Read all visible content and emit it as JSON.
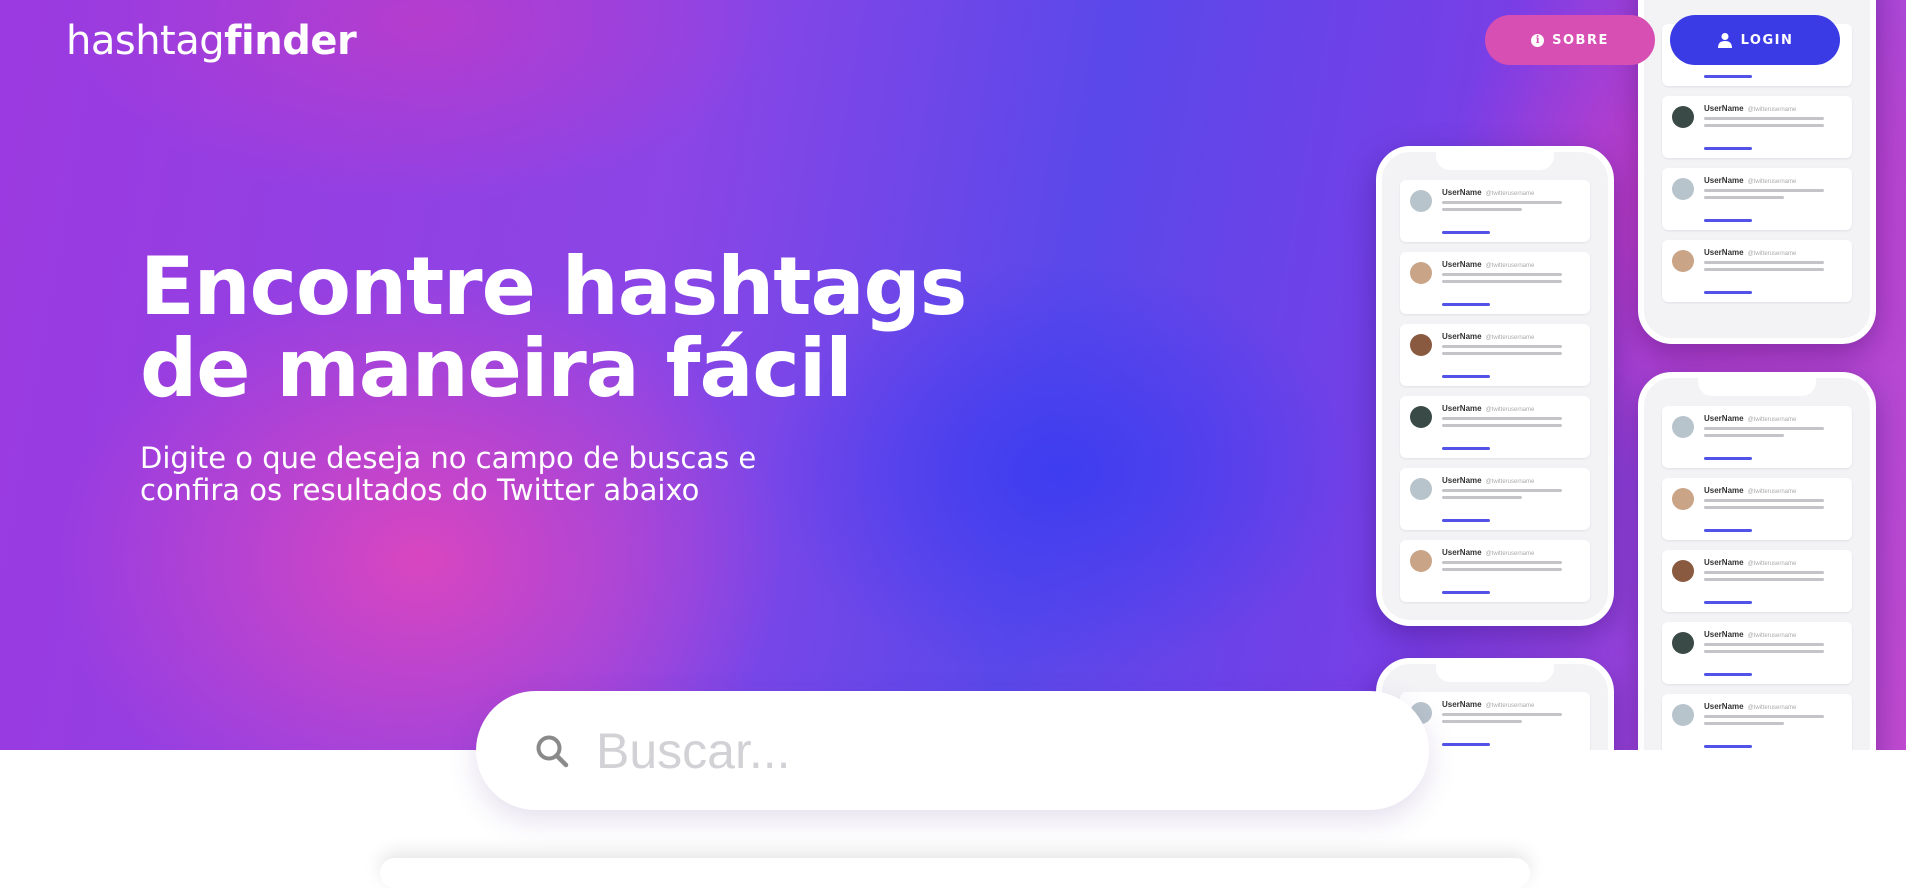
{
  "header": {
    "logo_part1": "hashtag",
    "logo_part2": "finder",
    "sobre_label": "SOBRE",
    "login_label": "LOGIN"
  },
  "hero": {
    "headline_line1": "Encontre hashtags",
    "headline_line2": "de maneira fácil",
    "subtitle_line1": "Digite o que deseja no campo de buscas e",
    "subtitle_line2": "confira os resultados do Twitter abaixo"
  },
  "search": {
    "placeholder": "Buscar...",
    "value": ""
  },
  "colors": {
    "sobre_button": "#d84fb4",
    "login_button": "#3b3be6",
    "hero_gradient": [
      "#9b3ae0",
      "#5a48ea",
      "#d84fb4"
    ]
  },
  "icons": {
    "sobre": "info-icon",
    "login": "user-icon",
    "search": "search-icon"
  }
}
